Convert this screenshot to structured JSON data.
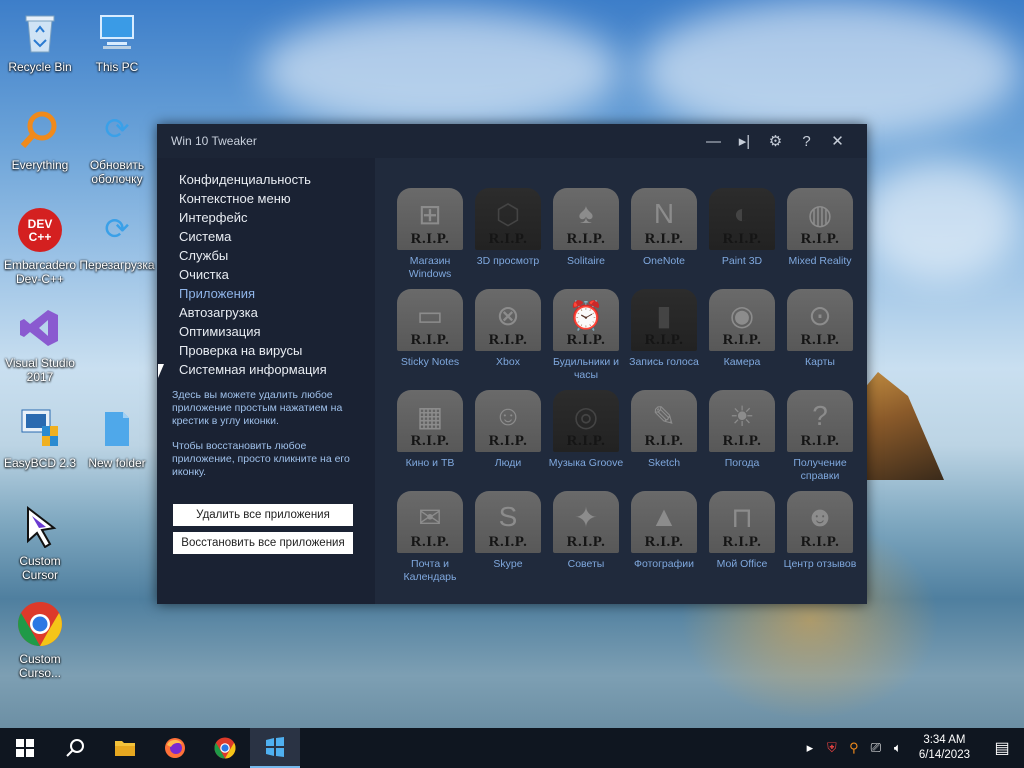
{
  "desktop_icons": [
    {
      "label": "Recycle Bin",
      "icon": "recycle-bin-icon"
    },
    {
      "label": "This PC",
      "icon": "computer-icon"
    },
    {
      "label": "Everything",
      "icon": "magnifier-icon"
    },
    {
      "label": "Обновить оболочку",
      "icon": "refresh-icon"
    },
    {
      "label": "Embarcadero Dev-C++",
      "icon": "devcpp-icon"
    },
    {
      "label": "Перезагрузка",
      "icon": "refresh-icon"
    },
    {
      "label": "Visual Studio 2017",
      "icon": "visual-studio-icon"
    },
    {
      "label": "EasyBCD 2.3",
      "icon": "easybcd-icon"
    },
    {
      "label": "New folder",
      "icon": "folder-icon"
    },
    {
      "label": "Custom Cursor",
      "icon": "cursor-icon"
    },
    {
      "label": "Custom Curso...",
      "icon": "chrome-icon"
    }
  ],
  "window": {
    "title": "Win 10 Tweaker",
    "controls": [
      "minimize-icon",
      "play-icon",
      "gear-icon",
      "help-icon",
      "close-icon"
    ],
    "nav": [
      "Конфиденциальность",
      "Контекстное меню",
      "Интерфейс",
      "Система",
      "Службы",
      "Очистка",
      "Приложения",
      "Автозагрузка",
      "Оптимизация",
      "Проверка на вирусы",
      "Системная информация"
    ],
    "active_nav": "Приложения",
    "help_text_1": "Здесь вы можете удалить любое приложение простым нажатием на крестик в углу иконки.",
    "help_text_2": "Чтобы восстановить любое приложение, просто кликните на его иконку.",
    "remove_all_label": "Удалить все приложения",
    "restore_all_label": "Восстановить все приложения",
    "rip_text": "R.I.P.",
    "apps": [
      {
        "label": "Магазин Windows",
        "icon": "store-icon"
      },
      {
        "label": "3D просмотр",
        "icon": "cube-icon",
        "dark": true
      },
      {
        "label": "Solitaire",
        "icon": "cards-icon"
      },
      {
        "label": "OneNote",
        "icon": "onenote-icon"
      },
      {
        "label": "Paint 3D",
        "icon": "paint-icon",
        "dark": true
      },
      {
        "label": "Mixed Reality",
        "icon": "headset-icon"
      },
      {
        "label": "Sticky Notes",
        "icon": "note-icon"
      },
      {
        "label": "Xbox",
        "icon": "xbox-icon"
      },
      {
        "label": "Будильники и часы",
        "icon": "alarm-icon"
      },
      {
        "label": "Запись голоса",
        "icon": "microphone-icon",
        "dark": true
      },
      {
        "label": "Камера",
        "icon": "camera-icon"
      },
      {
        "label": "Карты",
        "icon": "map-pin-icon"
      },
      {
        "label": "Кино и ТВ",
        "icon": "clapper-icon"
      },
      {
        "label": "Люди",
        "icon": "people-icon"
      },
      {
        "label": "Музыка Groove",
        "icon": "music-icon",
        "dark": true
      },
      {
        "label": "Sketch",
        "icon": "sketch-icon"
      },
      {
        "label": "Погода",
        "icon": "sun-icon"
      },
      {
        "label": "Получение справки",
        "icon": "help-bubble-icon"
      },
      {
        "label": "Почта и Календарь",
        "icon": "mail-icon"
      },
      {
        "label": "Skype",
        "icon": "skype-icon"
      },
      {
        "label": "Советы",
        "icon": "bulb-icon"
      },
      {
        "label": "Фотографии",
        "icon": "photo-icon"
      },
      {
        "label": "Мой Office",
        "icon": "office-icon"
      },
      {
        "label": "Центр отзывов",
        "icon": "feedback-icon"
      }
    ]
  },
  "taskbar": {
    "items": [
      "windows-start-icon",
      "search-icon",
      "file-explorer-icon",
      "firefox-icon",
      "chrome-icon",
      "win10tweaker-icon"
    ],
    "tray": [
      "chevron-up-icon",
      "shield-icon",
      "magnifier-icon",
      "network-icon",
      "volume-icon"
    ],
    "time": "3:34 AM",
    "date": "6/14/2023"
  }
}
